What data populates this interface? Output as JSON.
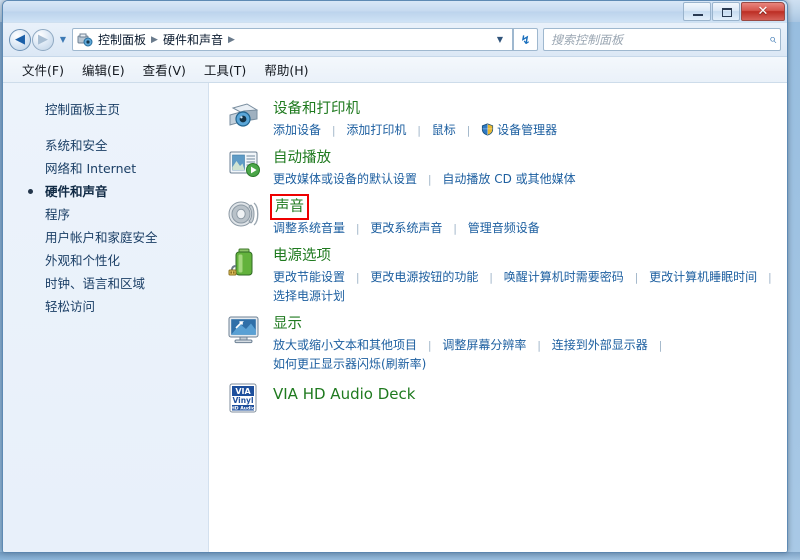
{
  "window": {
    "controls": {
      "minimize": "minimize-button",
      "maximize": "maximize-button",
      "close_label": "✕"
    }
  },
  "nav": {
    "back_glyph": "◀",
    "forward_glyph": "▶",
    "recent_caret": "▼",
    "breadcrumb": {
      "icon": "control-panel-icon",
      "items": [
        "控制面板",
        "硬件和声音"
      ],
      "separator": "▶",
      "trailing_separator": "▶",
      "dropdown_caret": "▼"
    },
    "refresh_glyph": "↯",
    "search": {
      "placeholder": "搜索控制面板",
      "value": "",
      "icon": "search-icon",
      "icon_glyph": "⌕"
    }
  },
  "menubar": {
    "items": [
      "文件(F)",
      "编辑(E)",
      "查看(V)",
      "工具(T)",
      "帮助(H)"
    ]
  },
  "sidebar": {
    "home": "控制面板主页",
    "items": [
      {
        "label": "系统和安全",
        "current": false
      },
      {
        "label": "网络和 Internet",
        "current": false
      },
      {
        "label": "硬件和声音",
        "current": true
      },
      {
        "label": "程序",
        "current": false
      },
      {
        "label": "用户帐户和家庭安全",
        "current": false
      },
      {
        "label": "外观和个性化",
        "current": false
      },
      {
        "label": "时钟、语言和区域",
        "current": false
      },
      {
        "label": "轻松访问",
        "current": false
      }
    ]
  },
  "main": {
    "categories": [
      {
        "icon": "devices-and-printers-icon",
        "title": "设备和打印机",
        "highlighted": false,
        "links": [
          {
            "text": "添加设备",
            "shield": false
          },
          {
            "text": "添加打印机",
            "shield": false
          },
          {
            "text": "鼠标",
            "shield": false
          },
          {
            "text": "设备管理器",
            "shield": true
          }
        ]
      },
      {
        "icon": "autoplay-icon",
        "title": "自动播放",
        "highlighted": false,
        "links": [
          {
            "text": "更改媒体或设备的默认设置",
            "shield": false
          },
          {
            "text": "自动播放 CD 或其他媒体",
            "shield": false
          }
        ]
      },
      {
        "icon": "sound-speaker-icon",
        "title": "声音",
        "highlighted": true,
        "links": [
          {
            "text": "调整系统音量",
            "shield": false
          },
          {
            "text": "更改系统声音",
            "shield": false
          },
          {
            "text": "管理音频设备",
            "shield": false
          }
        ]
      },
      {
        "icon": "power-options-icon",
        "title": "电源选项",
        "highlighted": false,
        "links": [
          {
            "text": "更改节能设置",
            "shield": false
          },
          {
            "text": "更改电源按钮的功能",
            "shield": false
          },
          {
            "text": "唤醒计算机时需要密码",
            "shield": false
          },
          {
            "text": "更改计算机睡眠时间",
            "shield": false
          },
          {
            "text": "选择电源计划",
            "shield": false
          }
        ]
      },
      {
        "icon": "display-monitor-icon",
        "title": "显示",
        "highlighted": false,
        "links": [
          {
            "text": "放大或缩小文本和其他项目",
            "shield": false
          },
          {
            "text": "调整屏幕分辨率",
            "shield": false
          },
          {
            "text": "连接到外部显示器",
            "shield": false
          },
          {
            "text": "如何更正显示器闪烁(刷新率)",
            "shield": false
          }
        ]
      }
    ],
    "app_entry": {
      "icon": "via-vinyl-hd-audio-icon",
      "icon_text_top": "VIA",
      "icon_text_mid": "Vinyl",
      "icon_text_bottom": "HD Audio",
      "title": "VIA HD Audio Deck"
    }
  },
  "colors": {
    "category_title": "#1f7a1f",
    "link": "#1d5fa0",
    "highlight_box": "#ee0000",
    "sidebar_bg": "#eaf1fa"
  }
}
